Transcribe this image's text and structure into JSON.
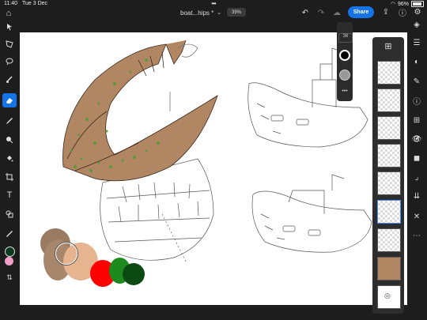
{
  "status_bar": {
    "time": "11:40",
    "date": "Tue 3 Dec",
    "battery": "96%"
  },
  "top_bar": {
    "document_title": "boat...hips *",
    "zoom_level": "39%",
    "share_label": "Share",
    "more_dots": "•••"
  },
  "brush_size_popup": {
    "size_value": "36"
  },
  "colors": {
    "accent": "#1473e6",
    "primary_color": "#0b3b1e",
    "secondary_color": "#f0a0c8"
  },
  "palette_swatches": [
    "#9b7a62",
    "#a8866c",
    "#e6b48e",
    "#ff0000",
    "#1c8a1c",
    "#0b4a12"
  ],
  "layers": {
    "count": 9,
    "selected_index": 5
  }
}
